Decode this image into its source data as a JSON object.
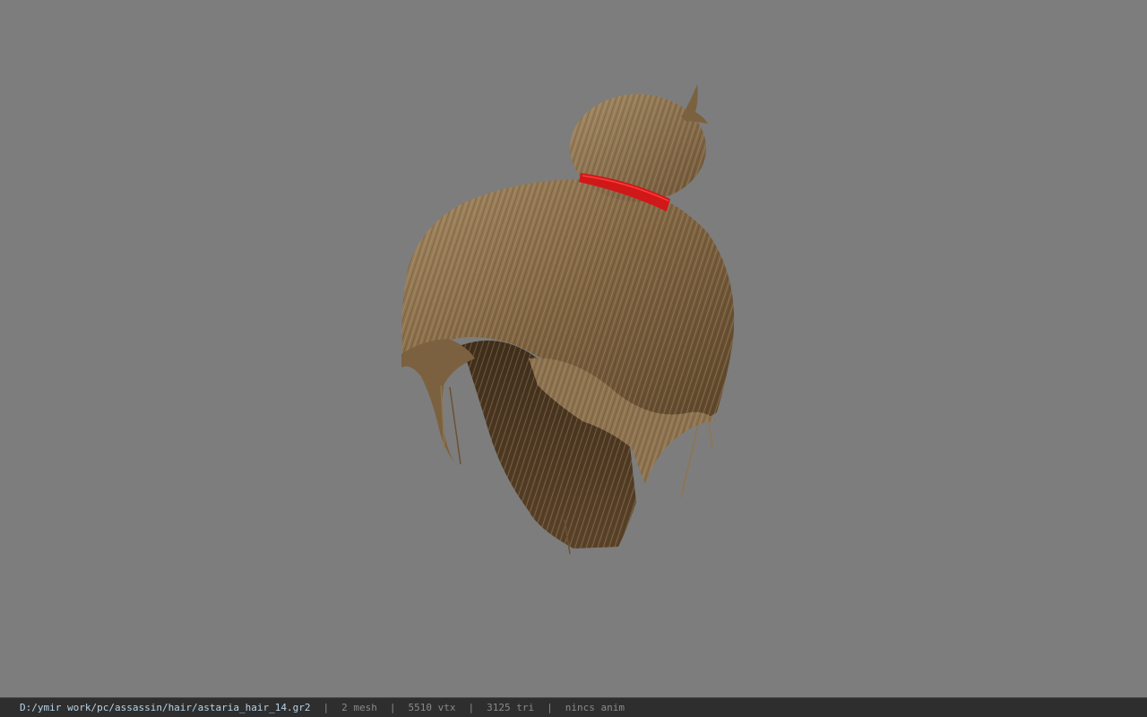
{
  "viewport": {
    "background_color": "#7d7d7d",
    "model": {
      "name": "hair-model",
      "hair_color": "#8a6e4b",
      "tie_color": "#d01818"
    }
  },
  "statusbar": {
    "file_path": "D:/ymir work/pc/assassin/hair/astaria_hair_14.gr2",
    "separator": "|",
    "mesh_count": "2 mesh",
    "vertex_count": "5510 vtx",
    "triangle_count": "3125 tri",
    "anim_status": "nincs anim"
  }
}
